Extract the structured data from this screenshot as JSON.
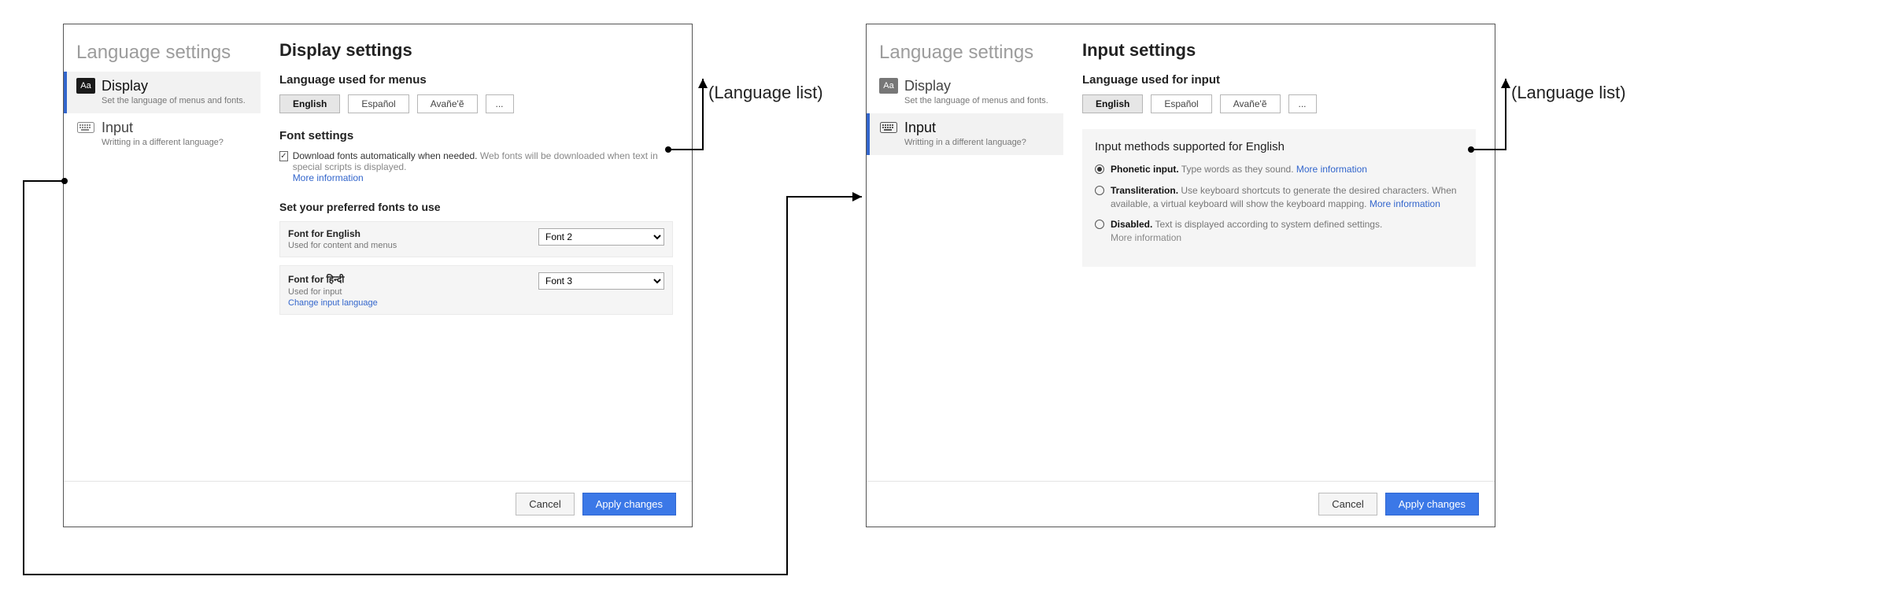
{
  "sidebar": {
    "title": "Language settings",
    "items": [
      {
        "icon": "Aa",
        "title": "Display",
        "sub": "Set the language of menus and fonts."
      },
      {
        "icon": "⌨",
        "title": "Input",
        "sub": "Writting in a different language?"
      }
    ]
  },
  "languages": [
    "English",
    "Español",
    "Avañe'ẽ"
  ],
  "more": "...",
  "display": {
    "title": "Display settings",
    "section_lang": "Language used for menus",
    "section_font": "Font settings",
    "checkbox_label": "Download fonts automatically when needed.",
    "checkbox_hint": "Web fonts will be downloaded when text in special scripts is displayed.",
    "more_info": "More information",
    "preferred_title": "Set your preferred fonts to use",
    "font_rows": [
      {
        "title": "Font for English",
        "sub": "Used for content and menus",
        "value": "Font 2"
      },
      {
        "title": "Font for  हिन्दी",
        "sub": "Used for input",
        "value": "Font 3",
        "link": "Change input language"
      }
    ]
  },
  "input": {
    "title": "Input settings",
    "section_lang": "Language used for input",
    "panel_title": "Input methods supported for English",
    "options": [
      {
        "label": "Phonetic input.",
        "desc": "Type words as they sound.",
        "link": "More information",
        "checked": true
      },
      {
        "label": "Transliteration.",
        "desc": "Use keyboard shortcuts to generate the desired characters. When available, a virtual keyboard will show the keyboard mapping.",
        "link": "More information",
        "checked": false
      },
      {
        "label": "Disabled.",
        "desc": "Text is displayed according to system defined settings.",
        "link_muted": "More information",
        "checked": false
      }
    ]
  },
  "footer": {
    "cancel": "Cancel",
    "apply": "Apply changes"
  },
  "annotations": {
    "lang_list": "(Language list)"
  }
}
